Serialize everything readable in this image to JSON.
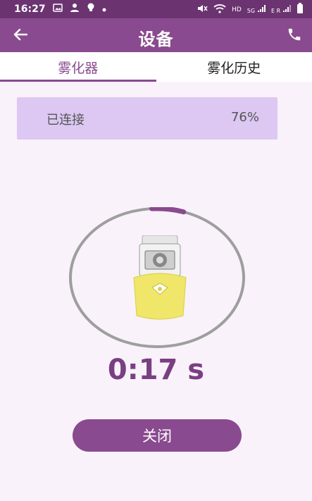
{
  "status_bar": {
    "time": "16:27",
    "icons": [
      "image-icon",
      "user-icon",
      "bulb-icon",
      "dot-icon",
      "mute-icon",
      "wifi-icon",
      "hd-icon",
      "signal-icon",
      "signal-icon-2",
      "battery-icon"
    ],
    "hd_label": "HD",
    "g_label": "5G",
    "er_label": "E R"
  },
  "app_bar": {
    "title": "设备",
    "back_icon": "arrow-left-icon",
    "phone_icon": "phone-icon"
  },
  "tabs": [
    {
      "label": "雾化器",
      "active": true
    },
    {
      "label": "雾化历史",
      "active": false
    }
  ],
  "device_status": {
    "status": "已连接",
    "battery": "76%"
  },
  "progress": {
    "fraction": 0.04
  },
  "timer": "0:17 s",
  "close_button": {
    "label": "关闭"
  },
  "colors": {
    "primary": "#8a4a8f",
    "status_bar": "#6b3471",
    "card": "#dcc8f2",
    "ring": "#9e9e9e",
    "background": "#f9f2fa"
  }
}
